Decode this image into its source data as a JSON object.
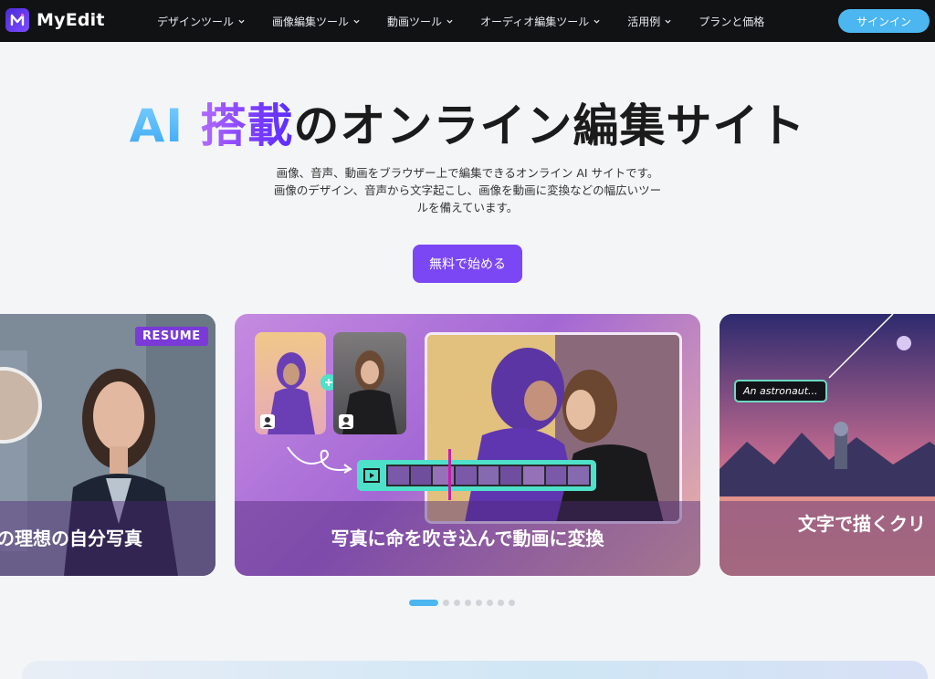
{
  "nav": {
    "brand": "MyEdit",
    "items": [
      {
        "label": "デザインツール",
        "has_dropdown": true
      },
      {
        "label": "画像編集ツール",
        "has_dropdown": true
      },
      {
        "label": "動画ツール",
        "has_dropdown": true
      },
      {
        "label": "オーディオ編集ツール",
        "has_dropdown": true
      },
      {
        "label": "活用例",
        "has_dropdown": true
      },
      {
        "label": "プランと価格",
        "has_dropdown": false
      }
    ],
    "signin_label": "サインイン"
  },
  "hero": {
    "title_ai": "AI",
    "title_tosai": "搭載",
    "title_rest": "のオンライン編集サイト",
    "desc_line1": "画像、音声、動画をブラウザー上で編集できるオンライン AI サイトです。",
    "desc_line2": "画像のデザイン、音声から文字起こし、画像を動画に変換などの幅広いツー",
    "desc_line3": "ルを備えています。",
    "cta_label": "無料で始める"
  },
  "carousel": {
    "cards": [
      {
        "caption": "の理想の自分写真",
        "badge": "RESUME"
      },
      {
        "caption": "写真に命を吹き込んで動画に変換"
      },
      {
        "caption": "文字で描くクリ",
        "tag": "An astronaut..."
      }
    ],
    "dot_count": 8,
    "active_dot": 0
  },
  "colors": {
    "nav_bg": "#111214",
    "accent_blue": "#4bb6f0",
    "accent_purple": "#7b47f4"
  }
}
